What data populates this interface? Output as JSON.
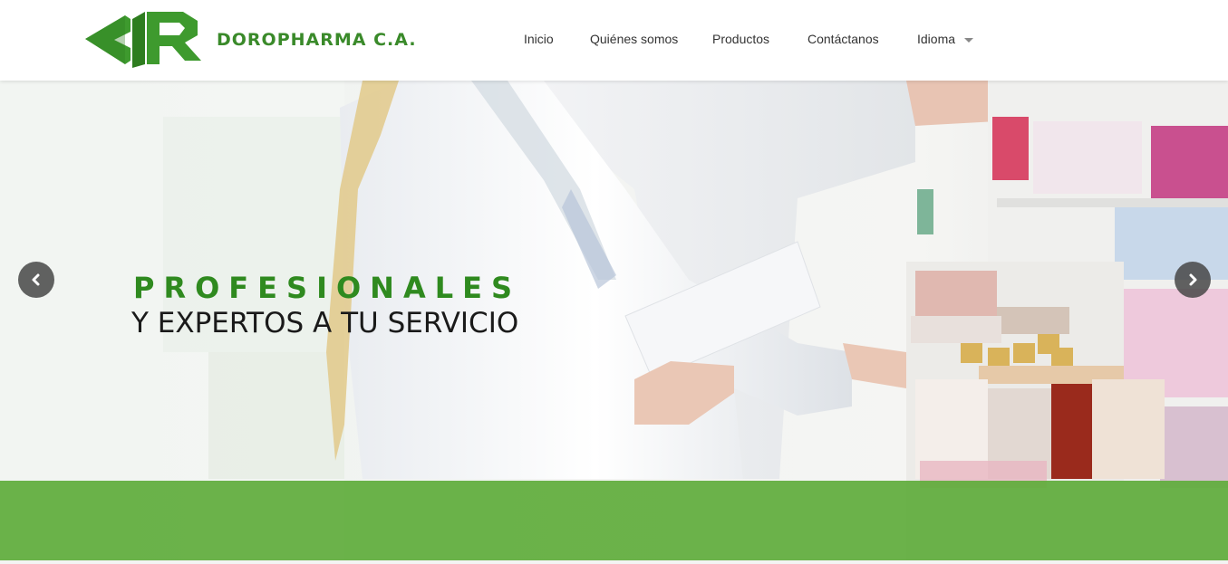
{
  "brand": {
    "name": "DOROPHARMA C.A.",
    "logo_icon": "doropharma-dr-logo-icon",
    "color_primary": "#3a8a2a",
    "color_logo_dark": "#2e7d1f"
  },
  "nav": {
    "items": [
      {
        "label": "Inicio"
      },
      {
        "label": "Quiénes somos"
      },
      {
        "label": "Productos"
      },
      {
        "label": "Contáctanos"
      },
      {
        "label": "Idioma",
        "has_dropdown": true
      }
    ]
  },
  "hero": {
    "title": "PROFESIONALES",
    "subtitle": "Y EXPERTOS A TU SERVICIO",
    "title_color": "#2f8a1f",
    "band_color": "#60ac3c",
    "prev_icon": "chevron-left-icon",
    "next_icon": "chevron-right-icon"
  }
}
